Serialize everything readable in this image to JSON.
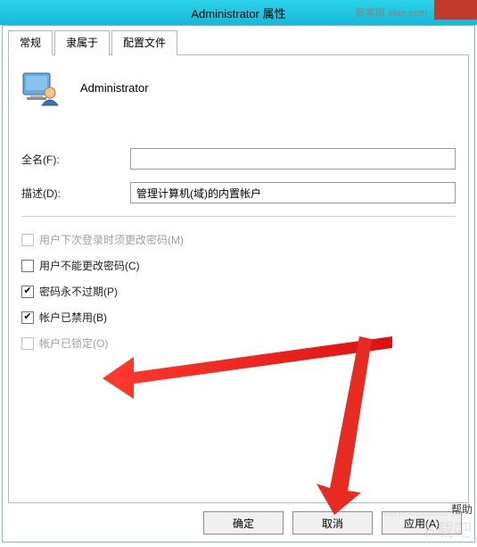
{
  "title": "Administrator 属性",
  "watermark_top": "新客网 xker.com",
  "watermark_br": "下载吧",
  "watermark_br2": "www.xiazaiba.com",
  "tabs": [
    {
      "label": "常规",
      "active": true
    },
    {
      "label": "隶属于",
      "active": false
    },
    {
      "label": "配置文件",
      "active": false
    }
  ],
  "user_name": "Administrator",
  "fields": {
    "fullname_label": "全名(F):",
    "fullname_value": "",
    "desc_label": "描述(D):",
    "desc_value": "管理计算机(域)的内置帐户"
  },
  "checks": {
    "must_change": {
      "label": "用户下次登录时须更改密码(M)",
      "checked": false,
      "disabled": true
    },
    "cant_change": {
      "label": "用户不能更改密码(C)",
      "checked": false,
      "disabled": false
    },
    "never_expire": {
      "label": "密码永不过期(P)",
      "checked": true,
      "disabled": false
    },
    "disabled_acct": {
      "label": "帐户已禁用(B)",
      "checked": true,
      "disabled": false
    },
    "locked": {
      "label": "帐户已锁定(O)",
      "checked": false,
      "disabled": true
    }
  },
  "buttons": {
    "ok": "确定",
    "cancel": "取消",
    "apply": "应用(A)"
  },
  "extra_label": "帮助"
}
